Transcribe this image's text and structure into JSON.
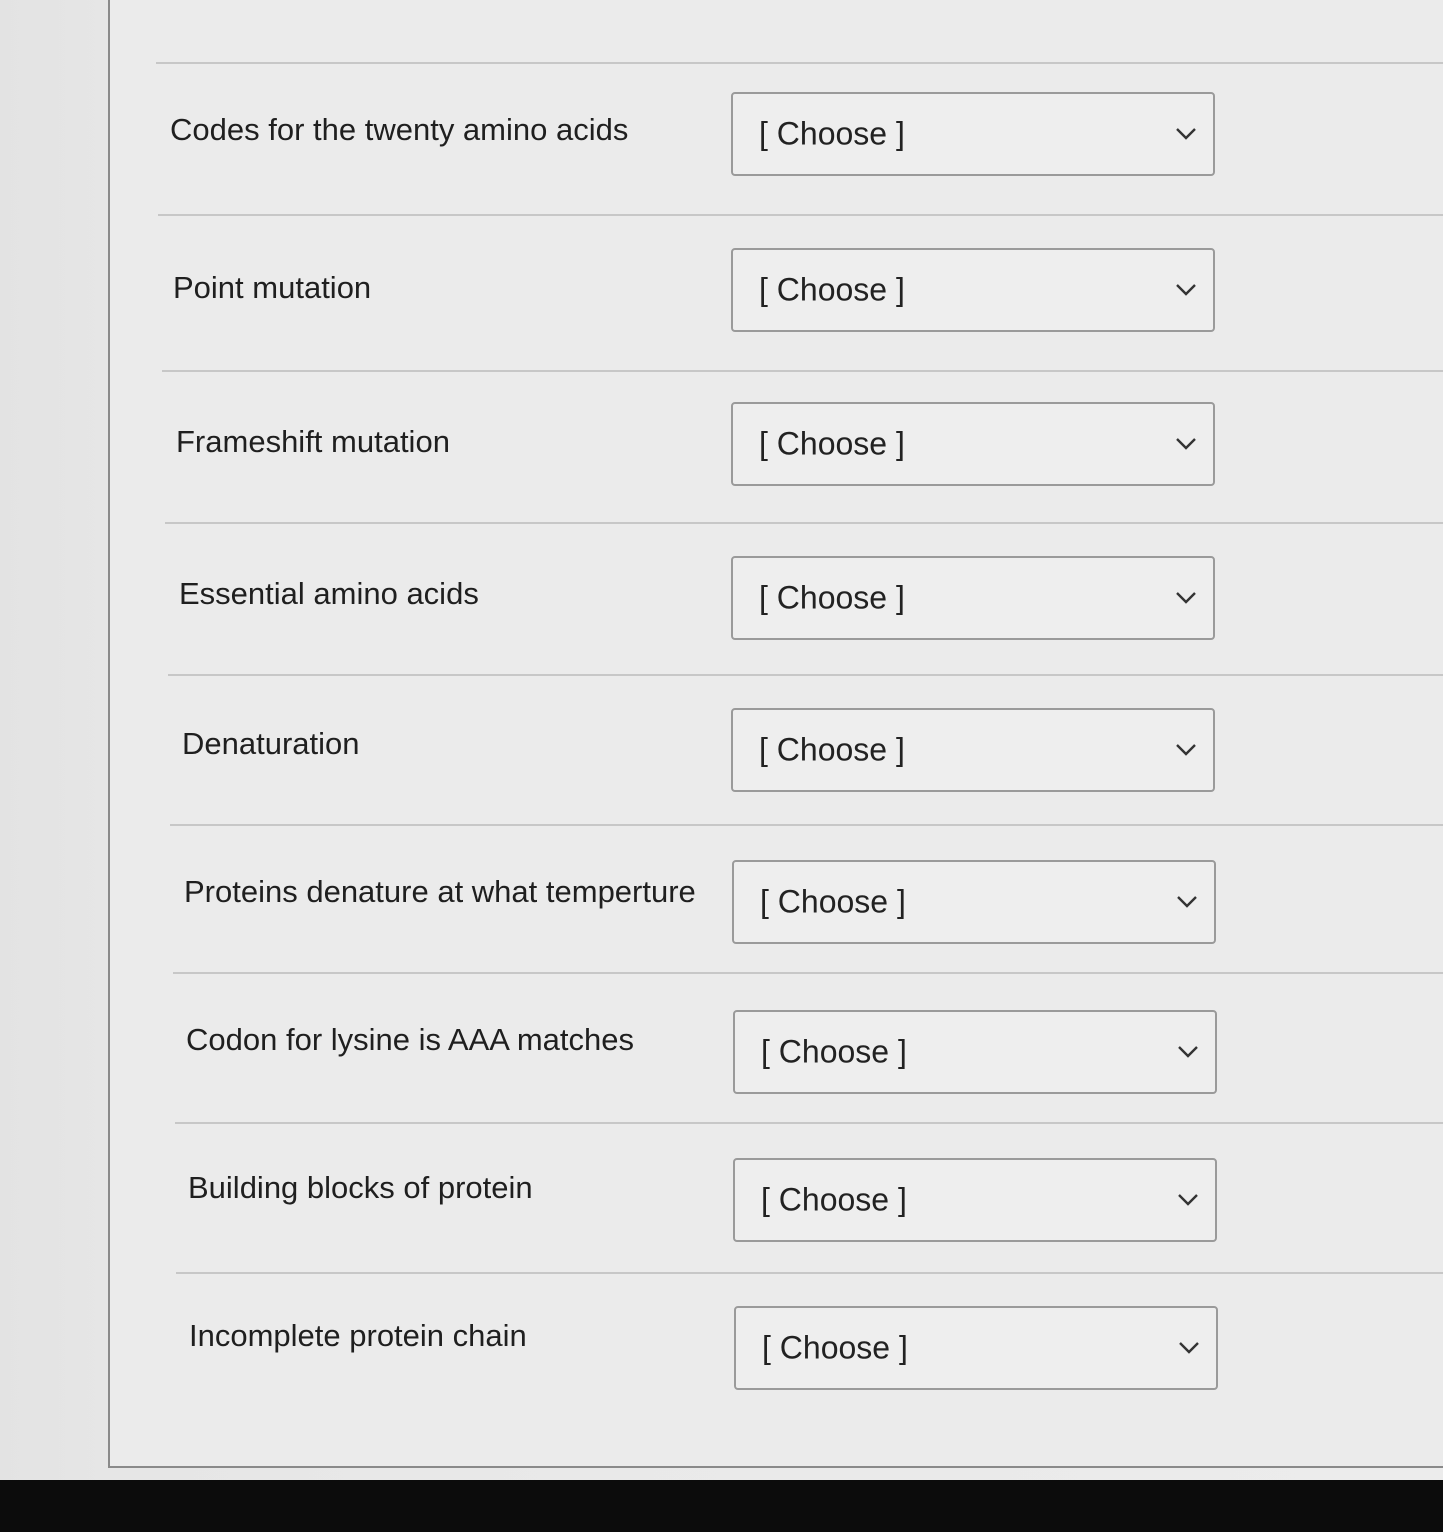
{
  "quiz": {
    "rows": [
      {
        "prompt": "Codes for the twenty amino acids",
        "selected": "[ Choose ]"
      },
      {
        "prompt": "Point mutation",
        "selected": "[ Choose ]"
      },
      {
        "prompt": "Frameshift mutation",
        "selected": "[ Choose ]"
      },
      {
        "prompt": "Essential amino acids",
        "selected": "[ Choose ]"
      },
      {
        "prompt": "Denaturation",
        "selected": "[ Choose ]"
      },
      {
        "prompt": "Proteins denature at what temperture",
        "selected": "[ Choose ]"
      },
      {
        "prompt": "Codon for lysine is AAA matches",
        "selected": "[ Choose ]"
      },
      {
        "prompt": "Building blocks of protein",
        "selected": "[ Choose ]"
      },
      {
        "prompt": "Incomplete protein chain",
        "selected": "[ Choose ]"
      }
    ]
  },
  "icons": {
    "dropdown": "chevron-down-icon"
  }
}
